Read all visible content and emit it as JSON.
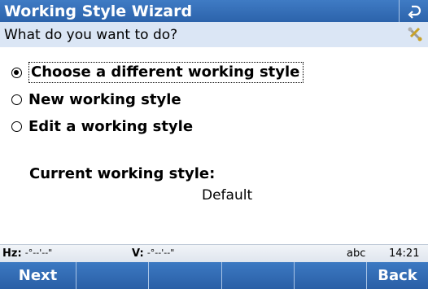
{
  "title": "Working Style Wizard",
  "back_icon": "undo-arrow-icon",
  "subheader": {
    "prompt": "What do you want to do?",
    "icon": "tools-icon"
  },
  "options": [
    {
      "label": "Choose a different working style",
      "checked": true
    },
    {
      "label": "New working style",
      "checked": false
    },
    {
      "label": "Edit a working style",
      "checked": false
    }
  ],
  "current": {
    "label": "Current working style:",
    "value": "Default"
  },
  "status": {
    "hz_label": "Hz:",
    "hz_value": "-°--'--\"",
    "v_label": "V:",
    "v_value": "-°--'--\"",
    "input_mode": "abc",
    "time": "14:21"
  },
  "softkeys": {
    "next": "Next",
    "back": "Back"
  },
  "colors": {
    "title_bar": "#2c63ab",
    "subheader_bg": "#dbe6f5"
  }
}
